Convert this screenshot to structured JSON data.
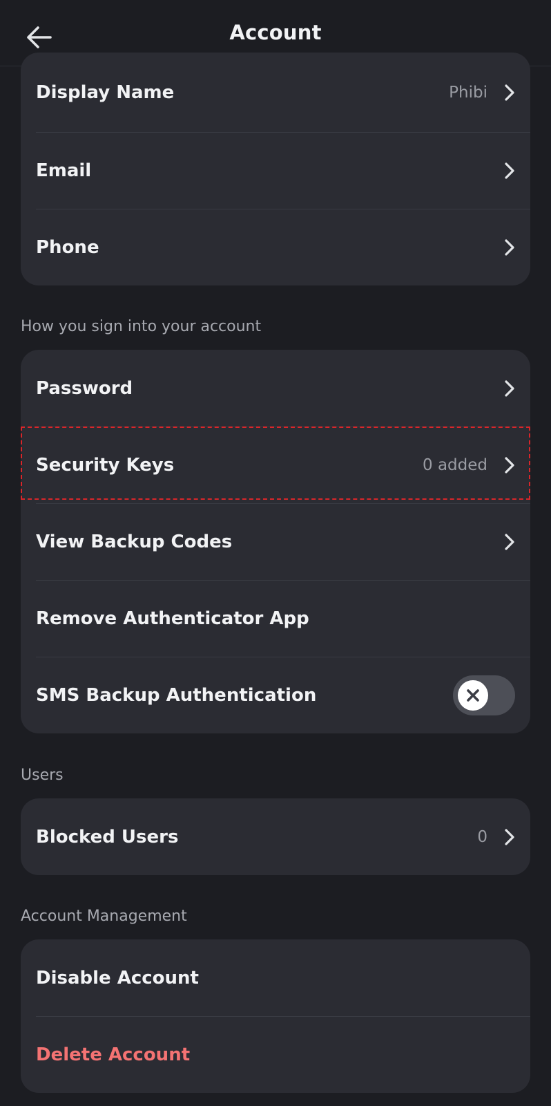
{
  "header": {
    "title": "Account",
    "back_icon": "arrow-left-icon"
  },
  "profile_card": {
    "items": [
      {
        "label": "Display Name",
        "value": "Phibi",
        "chevron": true
      },
      {
        "label": "Email",
        "value": "",
        "chevron": true
      },
      {
        "label": "Phone",
        "value": "",
        "chevron": true
      }
    ]
  },
  "sign_in_section": {
    "label": "How you sign into your account",
    "items": [
      {
        "label": "Password",
        "chevron": true
      },
      {
        "label": "Security Keys",
        "value": "0 added",
        "chevron": true,
        "highlighted": true
      },
      {
        "label": "View Backup Codes",
        "chevron": true
      },
      {
        "label": "Remove Authenticator App",
        "chevron": false
      },
      {
        "label": "SMS Backup Authentication",
        "toggle": false,
        "toggle_icon": "x-icon"
      }
    ]
  },
  "users_section": {
    "label": "Users",
    "items": [
      {
        "label": "Blocked Users",
        "value": "0",
        "chevron": true
      }
    ]
  },
  "account_management_section": {
    "label": "Account Management",
    "items": [
      {
        "label": "Disable Account"
      },
      {
        "label": "Delete Account",
        "danger": true
      }
    ]
  },
  "colors": {
    "background": "#1c1d22",
    "card": "#2b2c33",
    "danger": "#f47373",
    "highlight": "#d9262a",
    "toggle_off": "#4d4f57"
  }
}
